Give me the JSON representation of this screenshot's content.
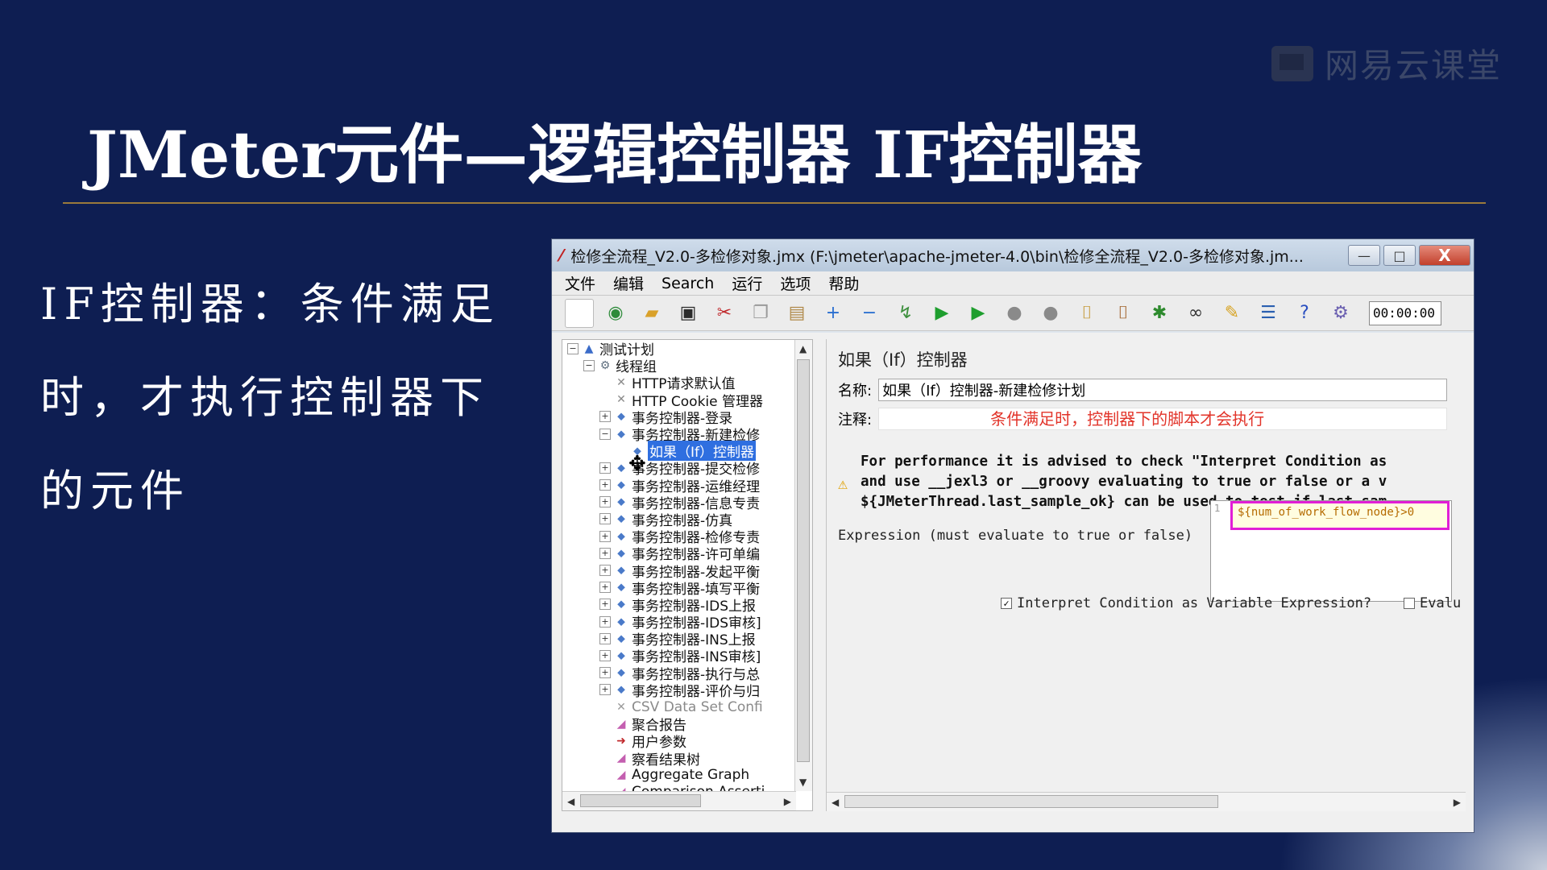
{
  "slide": {
    "title": "JMeter元件—逻辑控制器  IF控制器",
    "body": "IF控制器：条件满足时，才执行控制器下的元件",
    "watermark": "网易云课堂"
  },
  "window": {
    "title": "检修全流程_V2.0-多检修对象.jmx (F:\\jmeter\\apache-jmeter-4.0\\bin\\检修全流程_V2.0-多检修对象.jm...",
    "minimize": "—",
    "maximize": "□",
    "close": "X"
  },
  "menu": [
    "文件",
    "编辑",
    "Search",
    "运行",
    "选项",
    "帮助"
  ],
  "toolbar": {
    "icons": [
      "new-icon",
      "templates-icon",
      "open-icon",
      "save-icon",
      "cut-icon",
      "copy-icon",
      "paste-icon",
      "expand-icon",
      "collapse-icon",
      "toggle-icon",
      "start-icon",
      "start-no-pause-icon",
      "stop-icon",
      "shutdown-icon",
      "clear-icon",
      "clear-all-icon",
      "bug-icon",
      "search-icon",
      "reset-search-icon",
      "function-helper-icon",
      "help-icon",
      "remote-icon"
    ],
    "glyphs": [
      "▢",
      "◉",
      "▰",
      "▣",
      "✂",
      "❐",
      "▤",
      "+",
      "−",
      "↯",
      "▶",
      "▶",
      "●",
      "●",
      "⌷",
      "⌷",
      "✱",
      "∞",
      "✎",
      "☰",
      "?",
      "⚙"
    ],
    "colors": [
      "#ffffff",
      "#2e8b3a",
      "#d9a12a",
      "#2b2b2b",
      "#c0282b",
      "#9a9a9a",
      "#b08a4a",
      "#2a6fd0",
      "#2a6fd0",
      "#3c8f3c",
      "#1e9e2e",
      "#1e9e2e",
      "#8a8a8a",
      "#8a8a8a",
      "#c59a3a",
      "#a0622a",
      "#2d8a2d",
      "#333333",
      "#d7a21f",
      "#2a5fb0",
      "#2a4fc0",
      "#6a5fb0"
    ],
    "timer": "00:00:00"
  },
  "tree": {
    "items": [
      {
        "label": "测试计划",
        "level": 0,
        "expander": "−",
        "icon": "test-plan-icon",
        "glyph": "▲",
        "color": "#3b6cc9"
      },
      {
        "label": "线程组",
        "level": 1,
        "expander": "−",
        "icon": "thread-group-icon",
        "glyph": "⚙",
        "color": "#607080"
      },
      {
        "label": "HTTP请求默认值",
        "level": 2,
        "expander": "",
        "icon": "config-icon",
        "glyph": "✕",
        "color": "#8a8a8a"
      },
      {
        "label": "HTTP Cookie 管理器",
        "level": 2,
        "expander": "",
        "icon": "config-icon",
        "glyph": "✕",
        "color": "#8a8a8a"
      },
      {
        "label": "事务控制器-登录",
        "level": 2,
        "expander": "+",
        "icon": "transaction-controller-icon",
        "glyph": "⬥",
        "color": "#4a7ac9"
      },
      {
        "label": "事务控制器-新建检修",
        "level": 2,
        "expander": "−",
        "icon": "transaction-controller-icon",
        "glyph": "⬥",
        "color": "#4a7ac9"
      },
      {
        "label": "如果（If）控制器",
        "level": 3,
        "expander": "",
        "icon": "if-controller-icon",
        "glyph": "⬥",
        "color": "#4a7ac9",
        "selected": true
      },
      {
        "label": "事务控制器-提交检修",
        "level": 2,
        "expander": "+",
        "icon": "transaction-controller-icon",
        "glyph": "⬥",
        "color": "#4a7ac9"
      },
      {
        "label": "事务控制器-运维经理",
        "level": 2,
        "expander": "+",
        "icon": "transaction-controller-icon",
        "glyph": "⬥",
        "color": "#4a7ac9"
      },
      {
        "label": "事务控制器-信息专责",
        "level": 2,
        "expander": "+",
        "icon": "transaction-controller-icon",
        "glyph": "⬥",
        "color": "#4a7ac9"
      },
      {
        "label": "事务控制器-仿真",
        "level": 2,
        "expander": "+",
        "icon": "transaction-controller-icon",
        "glyph": "⬥",
        "color": "#4a7ac9"
      },
      {
        "label": "事务控制器-检修专责",
        "level": 2,
        "expander": "+",
        "icon": "transaction-controller-icon",
        "glyph": "⬥",
        "color": "#4a7ac9"
      },
      {
        "label": "事务控制器-许可单编",
        "level": 2,
        "expander": "+",
        "icon": "transaction-controller-icon",
        "glyph": "⬥",
        "color": "#4a7ac9"
      },
      {
        "label": "事务控制器-发起平衡",
        "level": 2,
        "expander": "+",
        "icon": "transaction-controller-icon",
        "glyph": "⬥",
        "color": "#4a7ac9"
      },
      {
        "label": "事务控制器-填写平衡",
        "level": 2,
        "expander": "+",
        "icon": "transaction-controller-icon",
        "glyph": "⬥",
        "color": "#4a7ac9"
      },
      {
        "label": "事务控制器-IDS上报",
        "level": 2,
        "expander": "+",
        "icon": "transaction-controller-icon",
        "glyph": "⬥",
        "color": "#4a7ac9"
      },
      {
        "label": "事务控制器-IDS审核]",
        "level": 2,
        "expander": "+",
        "icon": "transaction-controller-icon",
        "glyph": "⬥",
        "color": "#4a7ac9"
      },
      {
        "label": "事务控制器-INS上报",
        "level": 2,
        "expander": "+",
        "icon": "transaction-controller-icon",
        "glyph": "⬥",
        "color": "#4a7ac9"
      },
      {
        "label": "事务控制器-INS审核]",
        "level": 2,
        "expander": "+",
        "icon": "transaction-controller-icon",
        "glyph": "⬥",
        "color": "#4a7ac9"
      },
      {
        "label": "事务控制器-执行与总",
        "level": 2,
        "expander": "+",
        "icon": "transaction-controller-icon",
        "glyph": "⬥",
        "color": "#4a7ac9"
      },
      {
        "label": "事务控制器-评价与归",
        "level": 2,
        "expander": "+",
        "icon": "transaction-controller-icon",
        "glyph": "⬥",
        "color": "#4a7ac9"
      },
      {
        "label": "CSV Data Set Confi",
        "level": 2,
        "expander": "",
        "icon": "csv-config-icon",
        "glyph": "✕",
        "color": "#9a9a9a",
        "disabled": true
      },
      {
        "label": "聚合报告",
        "level": 2,
        "expander": "",
        "icon": "listener-icon",
        "glyph": "◢",
        "color": "#c45fb0"
      },
      {
        "label": "用户参数",
        "level": 2,
        "expander": "",
        "icon": "preprocessor-icon",
        "glyph": "➜",
        "color": "#c0282b"
      },
      {
        "label": "察看结果树",
        "level": 2,
        "expander": "",
        "icon": "listener-icon",
        "glyph": "◢",
        "color": "#c45fb0"
      },
      {
        "label": "Aggregate Graph",
        "level": 2,
        "expander": "",
        "icon": "listener-icon",
        "glyph": "◢",
        "color": "#c45fb0"
      },
      {
        "label": "Comparison Asserti",
        "level": 2,
        "expander": "",
        "icon": "assertion-icon",
        "glyph": "◢",
        "color": "#c45fb0"
      }
    ]
  },
  "panel": {
    "title": "如果（If）控制器",
    "name_label": "名称:",
    "name_value": "如果（If）控制器-新建检修计划",
    "comment_label": "注释:",
    "comment_value": "条件满足时，控制器下的脚本才会执行",
    "warning_lines": [
      "For performance it is advised to check \"Interpret Condition as",
      "and use __jexl3 or __groovy evaluating to true or false or a v",
      "${JMeterThread.last_sample_ok} can be used to test if last sam"
    ],
    "expression_label": "Expression (must evaluate to true or false)",
    "line_number": "1",
    "expression": "${num_of_work_flow_node}>0",
    "interpret_checkbox": {
      "label": "Interpret Condition as Variable Expression?",
      "checked": true,
      "mark": "✓"
    },
    "evaluate_checkbox": {
      "label": "Evalu",
      "checked": false,
      "mark": ""
    }
  }
}
